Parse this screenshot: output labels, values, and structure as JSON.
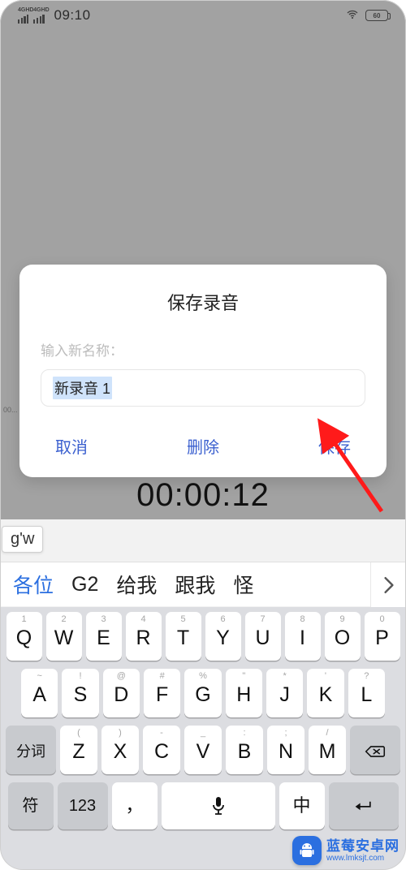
{
  "status": {
    "net_label": "4GHD",
    "time": "09:10",
    "battery": "60"
  },
  "tick": "00...",
  "modal": {
    "title": "保存录音",
    "label": "输入新名称：",
    "value": "新录音 1",
    "cancel": "取消",
    "delete": "删除",
    "save": "保存"
  },
  "timer": "00:00:12",
  "compose": "g'w",
  "candidates": [
    "各位",
    "G2",
    "给我",
    "跟我",
    "怪"
  ],
  "keyboard": {
    "row1": [
      {
        "sup": "1",
        "main": "Q"
      },
      {
        "sup": "2",
        "main": "W"
      },
      {
        "sup": "3",
        "main": "E"
      },
      {
        "sup": "4",
        "main": "R"
      },
      {
        "sup": "5",
        "main": "T"
      },
      {
        "sup": "6",
        "main": "Y"
      },
      {
        "sup": "7",
        "main": "U"
      },
      {
        "sup": "8",
        "main": "I"
      },
      {
        "sup": "9",
        "main": "O"
      },
      {
        "sup": "0",
        "main": "P"
      }
    ],
    "row2": [
      {
        "sup": "~",
        "main": "A"
      },
      {
        "sup": "!",
        "main": "S"
      },
      {
        "sup": "@",
        "main": "D"
      },
      {
        "sup": "#",
        "main": "F"
      },
      {
        "sup": "%",
        "main": "G"
      },
      {
        "sup": "\"",
        "main": "H"
      },
      {
        "sup": "*",
        "main": "J"
      },
      {
        "sup": "'",
        "main": "K"
      },
      {
        "sup": "?",
        "main": "L"
      }
    ],
    "row3_left": "分词",
    "row3_keys": [
      {
        "sup": "(",
        "main": "Z"
      },
      {
        "sup": ")",
        "main": "X"
      },
      {
        "sup": "-",
        "main": "C"
      },
      {
        "sup": "_",
        "main": "V"
      },
      {
        "sup": ":",
        "main": "B"
      },
      {
        "sup": ";",
        "main": "N"
      },
      {
        "sup": "/",
        "main": "M"
      }
    ],
    "row4": {
      "sym": "符",
      "num": "123",
      "comma": "，",
      "lang": "中",
      "enter": "↵"
    }
  },
  "watermark": {
    "name": "蓝莓安卓网",
    "url": "www.lmksjt.com"
  }
}
